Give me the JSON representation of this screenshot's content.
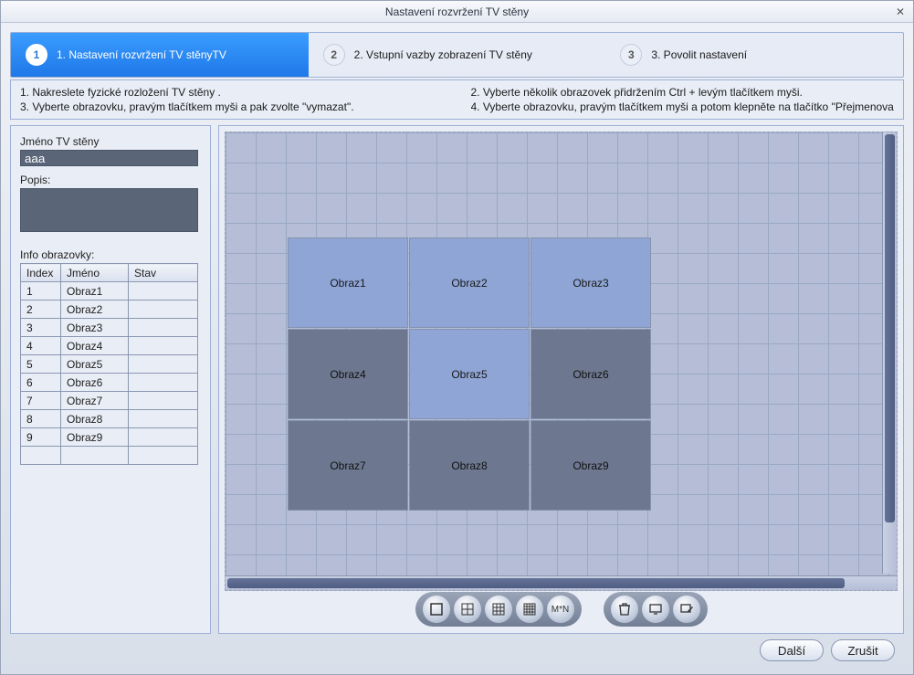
{
  "window": {
    "title": "Nastavení rozvržení TV stěny"
  },
  "wizard": {
    "steps": [
      {
        "num": "1",
        "label": "1. Nastavení rozvržení TV stěnyTV"
      },
      {
        "num": "2",
        "label": "2. Vstupní vazby zobrazení TV stěny"
      },
      {
        "num": "3",
        "label": "3. Povolit nastavení"
      }
    ]
  },
  "instructions": {
    "i1": "1. Nakreslete fyzické rozložení TV stěny .",
    "i2": "2. Vyberte několik obrazovek přidržením Ctrl + levým tlačítkem myši.",
    "i3": "3. Vyberte obrazovku, pravým tlačítkem myši a pak zvolte \"vymazat\".",
    "i4": "4. Vyberte obrazovku, pravým tlačítkem myši a potom klepněte na tlačítko \"Přejmenova"
  },
  "sidebar": {
    "name_label": "Jméno TV stěny",
    "name_value": "aaa",
    "desc_label": "Popis:",
    "desc_value": "",
    "info_label": "Info obrazovky:",
    "columns": {
      "index": "Index",
      "name": "Jméno",
      "status": "Stav"
    },
    "rows": [
      {
        "index": "1",
        "name": "Obraz1",
        "status": ""
      },
      {
        "index": "2",
        "name": "Obraz2",
        "status": ""
      },
      {
        "index": "3",
        "name": "Obraz3",
        "status": ""
      },
      {
        "index": "4",
        "name": "Obraz4",
        "status": ""
      },
      {
        "index": "5",
        "name": "Obraz5",
        "status": ""
      },
      {
        "index": "6",
        "name": "Obraz6",
        "status": ""
      },
      {
        "index": "7",
        "name": "Obraz7",
        "status": ""
      },
      {
        "index": "8",
        "name": "Obraz8",
        "status": ""
      },
      {
        "index": "9",
        "name": "Obraz9",
        "status": ""
      }
    ]
  },
  "screens": [
    {
      "label": "Obraz1",
      "tone": "blue"
    },
    {
      "label": "Obraz2",
      "tone": "blue"
    },
    {
      "label": "Obraz3",
      "tone": "blue"
    },
    {
      "label": "Obraz4",
      "tone": "gray"
    },
    {
      "label": "Obraz5",
      "tone": "blue"
    },
    {
      "label": "Obraz6",
      "tone": "gray"
    },
    {
      "label": "Obraz7",
      "tone": "gray"
    },
    {
      "label": "Obraz8",
      "tone": "gray"
    },
    {
      "label": "Obraz9",
      "tone": "gray"
    }
  ],
  "toolbar": {
    "mn_label": "M*N"
  },
  "footer": {
    "next": "Další",
    "cancel": "Zrušit"
  }
}
